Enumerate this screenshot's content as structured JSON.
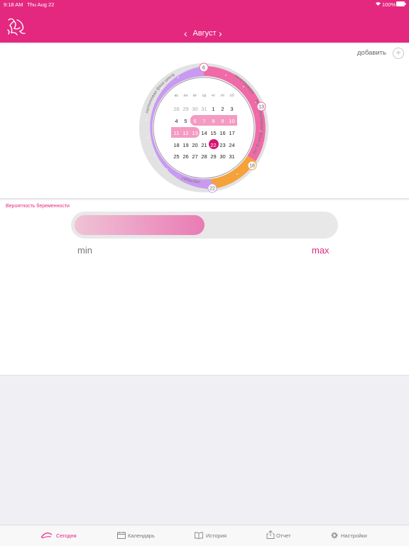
{
  "status": {
    "time": "9:18 AM",
    "date": "Thu Aug 22",
    "battery": "100%"
  },
  "header": {
    "month": "Август",
    "prev_icon": "chevron-left-icon",
    "next_icon": "chevron-right-icon"
  },
  "cycle": {
    "add_label": "добавить",
    "phases": [
      "лютеиновая фаза цикла",
      "менструация",
      "фолликулярная фаза цикла",
      "овуляция"
    ],
    "markers": [
      "6",
      "13",
      "18",
      "22"
    ],
    "colors": {
      "luteal": "#c99bf0",
      "menstruation": "#f06aa8",
      "follicular": "#f06aa8",
      "ovulation": "#f5a23a",
      "today": "#d31573"
    }
  },
  "calendar": {
    "weekdays": [
      "вс",
      "пн",
      "вт",
      "ср",
      "чт",
      "пт",
      "сб"
    ],
    "rows": [
      [
        "28",
        "29",
        "30",
        "31",
        "1",
        "2",
        "3"
      ],
      [
        "4",
        "5",
        "6",
        "7",
        "8",
        "9",
        "10"
      ],
      [
        "11",
        "12",
        "13",
        "14",
        "15",
        "16",
        "17"
      ],
      [
        "18",
        "19",
        "20",
        "21",
        "22",
        "23",
        "24"
      ],
      [
        "25",
        "26",
        "27",
        "28",
        "29",
        "30",
        "31"
      ]
    ],
    "today": "22"
  },
  "probability": {
    "title": "Вероятность беременности",
    "min": "min",
    "max": "max",
    "level": 0.5
  },
  "tabs": [
    {
      "label": "Сегодня",
      "icon": "today-icon",
      "active": true
    },
    {
      "label": "Календарь",
      "icon": "calendar-icon",
      "active": false
    },
    {
      "label": "История",
      "icon": "book-icon",
      "active": false
    },
    {
      "label": "Отчет",
      "icon": "share-icon",
      "active": false
    },
    {
      "label": "Настройки",
      "icon": "gear-icon",
      "active": false
    }
  ]
}
